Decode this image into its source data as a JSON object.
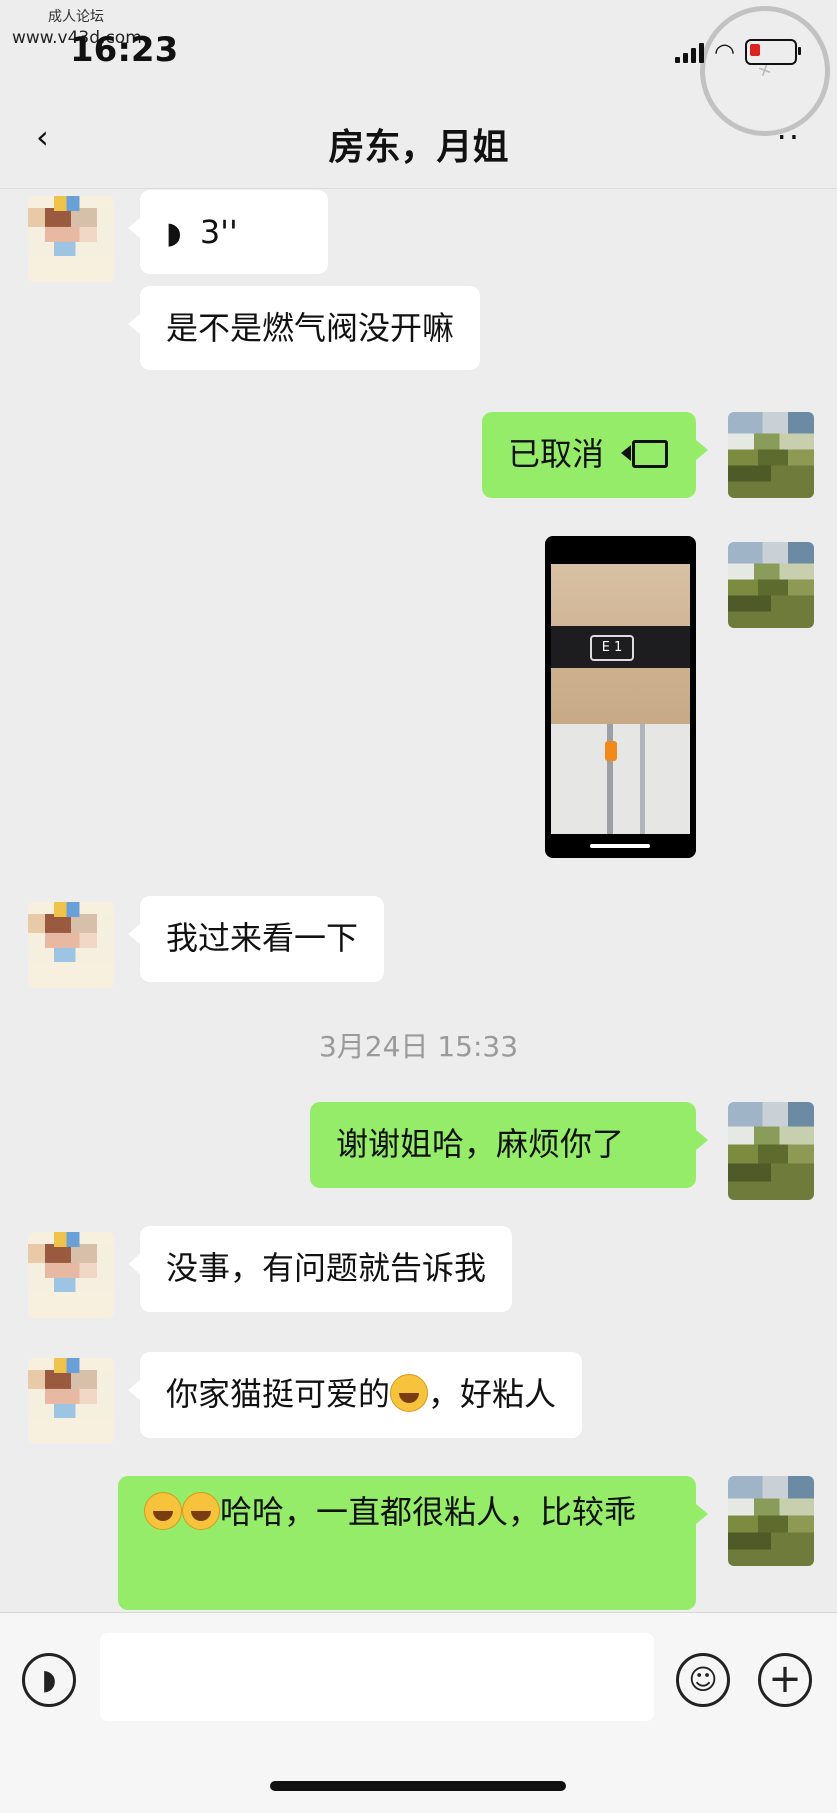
{
  "watermark": {
    "text": "成人论坛",
    "url": "www.v43d.com"
  },
  "status_bar": {
    "time": "16:23"
  },
  "header": {
    "title": "房东，月姐",
    "back_icon": "back-chevron-icon",
    "more_icon": "more-dots-icon"
  },
  "messages": [
    {
      "side": "left",
      "type": "voice",
      "text": "3''"
    },
    {
      "side": "left",
      "type": "text",
      "text": "是不是燃气阀没开嘛"
    },
    {
      "side": "right",
      "type": "video-call",
      "text": "已取消"
    },
    {
      "side": "right",
      "type": "image",
      "display_text": "E 1"
    },
    {
      "side": "left",
      "type": "text",
      "text": "我过来看一下"
    },
    {
      "side": "right",
      "type": "text",
      "text": "谢谢姐哈，麻烦你了"
    },
    {
      "side": "left",
      "type": "text",
      "text": "没事，有问题就告诉我"
    },
    {
      "side": "left",
      "type": "text",
      "text_before": "你家猫挺可爱的",
      "text_after": "，好粘人"
    },
    {
      "side": "right",
      "type": "text",
      "text": "哈哈，一直都很粘人，比较乖"
    }
  ],
  "timestamp": "3月24日 15:33",
  "input_bar": {
    "placeholder": "",
    "voice_icon": "voice-icon",
    "emoji_icon": "emoji-icon",
    "plus_icon": "plus-icon"
  },
  "colors": {
    "background": "#ededed",
    "bubble_sent": "#95ec69",
    "bubble_received": "#ffffff"
  }
}
